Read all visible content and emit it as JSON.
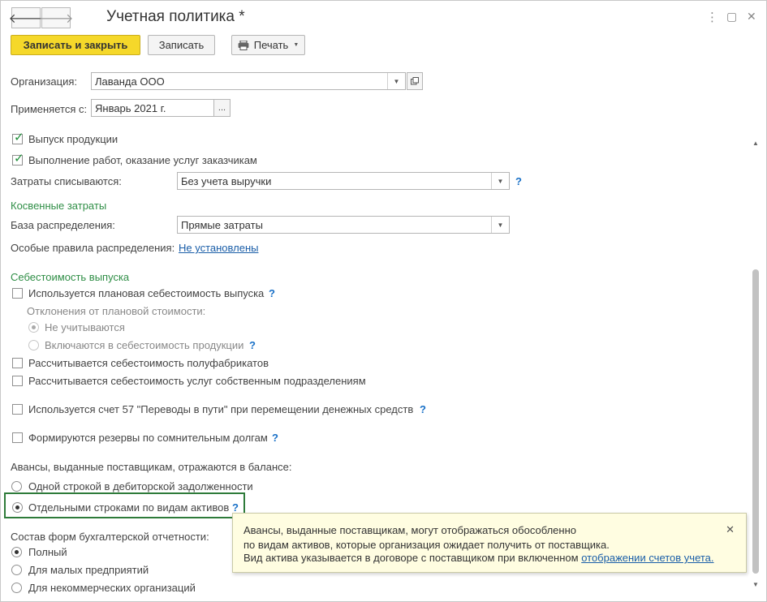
{
  "header": {
    "title": "Учетная политика *",
    "back_glyph": "🡐",
    "forward_glyph": "🡒",
    "more_glyph": "⋮",
    "maximize_glyph": "▢",
    "close_glyph": "✕"
  },
  "toolbar": {
    "save_close": "Записать и закрыть",
    "save": "Записать",
    "print": "Печать"
  },
  "fields": {
    "org_label": "Организация:",
    "org_value": "Лаванда ООО",
    "applies_label": "Применяется с:",
    "applies_value": "Январь 2021 г.",
    "ellipsis": "..."
  },
  "checks": {
    "production": "Выпуск продукции",
    "works": "Выполнение работ, оказание услуг заказчикам"
  },
  "costs": {
    "label": "Затраты списываются:",
    "value": "Без учета выручки"
  },
  "indirect": {
    "section": "Косвенные затраты",
    "base_label": "База распределения:",
    "base_value": "Прямые затраты",
    "rules_label": "Особые правила распределения:",
    "rules_link": "Не установлены"
  },
  "cost_output": {
    "section": "Себестоимость выпуска",
    "planned": "Используется плановая себестоимость выпуска",
    "deviation_label": "Отклонения от плановой стоимости:",
    "not_counted": "Не учитываются",
    "included": "Включаются в себестоимость продукции",
    "semi": "Рассчитывается себестоимость полуфабрикатов",
    "services": "Рассчитывается себестоимость услуг собственным подразделениям",
    "account57": "Используется счет 57 \"Переводы в пути\" при перемещении денежных средств",
    "reserves": "Формируются резервы по сомнительным долгам"
  },
  "advances": {
    "label": "Авансы, выданные поставщикам, отражаются в балансе:",
    "one_line": "Одной строкой в дебиторской задолженности",
    "separate": "Отдельными строками по видам активов"
  },
  "forms": {
    "label": "Состав форм бухгалтерской отчетности:",
    "full": "Полный",
    "small": "Для малых предприятий",
    "nonprofit": "Для некоммерческих организаций"
  },
  "tooltip": {
    "line1": "Авансы, выданные поставщикам, могут отображаться обособленно",
    "line2": "по видам активов, которые организация ожидает получить от поставщика.",
    "line3": "Вид актива указывается в договоре с поставщиком при включенном",
    "link": "отображении счетов учета."
  },
  "help_mark": "?",
  "colors": {
    "primary_button": "#f5d82a",
    "section_green": "#2f8e46",
    "help_blue": "#1870c7",
    "link_blue": "#1a5ea8",
    "tooltip_bg": "#fffde1",
    "focus_border": "#2e7b3a"
  }
}
